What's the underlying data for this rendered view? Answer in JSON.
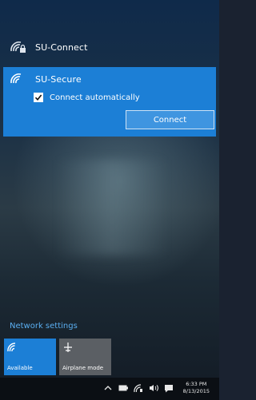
{
  "networks": {
    "other": {
      "name": "SU-Connect",
      "icon": "wifi-secured-icon"
    },
    "selected": {
      "name": "SU-Secure",
      "icon": "wifi-secured-icon",
      "auto_connect_label": "Connect automatically",
      "auto_connect_checked": true,
      "connect_label": "Connect"
    }
  },
  "network_settings_label": "Network settings",
  "quick_actions": [
    {
      "label": "Available",
      "icon": "wifi-icon",
      "active": true
    },
    {
      "label": "Airplane mode",
      "icon": "airplane-icon",
      "active": false
    }
  ],
  "taskbar": {
    "time": "6:33 PM",
    "date": "8/13/2015",
    "icons": [
      "chevron-up-icon",
      "battery-icon",
      "network-icon",
      "volume-icon",
      "notification-icon"
    ]
  },
  "colors": {
    "accent": "#1c7fd6",
    "link": "#5aaef0"
  }
}
